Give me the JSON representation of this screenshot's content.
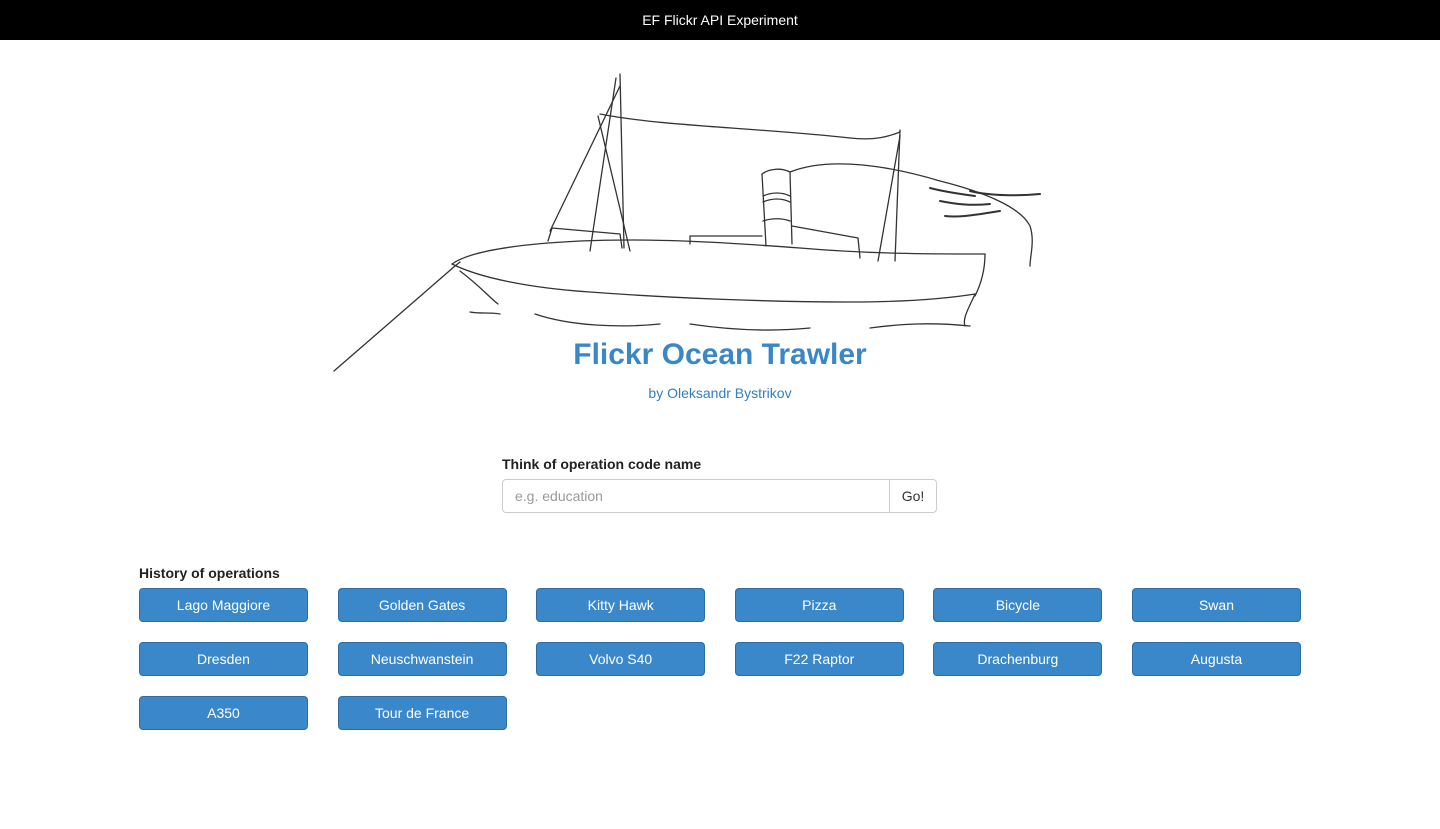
{
  "header": {
    "title": "EF Flickr API Experiment"
  },
  "hero": {
    "image": "hand-drawn-trawler-ship-sketch"
  },
  "page": {
    "title": "Flickr Ocean Trawler",
    "byline": "by Oleksandr Bystrikov"
  },
  "search": {
    "label": "Think of operation code name",
    "placeholder": "e.g. education",
    "value": "",
    "go_label": "Go!"
  },
  "history": {
    "label": "History of operations",
    "items": [
      "Lago Maggiore",
      "Golden Gates",
      "Kitty Hawk",
      "Pizza",
      "Bicycle",
      "Swan",
      "Dresden",
      "Neuschwanstein",
      "Volvo S40",
      "F22 Raptor",
      "Drachenburg",
      "Augusta",
      "A350",
      "Tour de France"
    ]
  },
  "colors": {
    "topbar": "#000000",
    "title": "#3a87c7",
    "primary_button": "#3a87c9"
  }
}
